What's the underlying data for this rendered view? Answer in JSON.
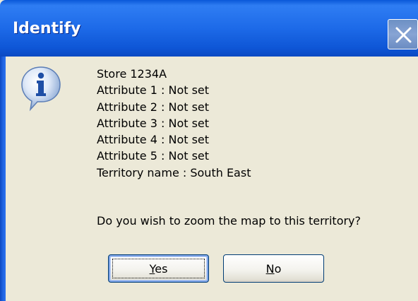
{
  "window": {
    "title": "Identify"
  },
  "message": {
    "lines": [
      "Store 1234A",
      "Attribute 1 : Not set",
      "Attribute 2 : Not set",
      "Attribute 3 : Not set",
      "Attribute 4 : Not set",
      "Attribute 5 : Not set",
      "Territory name : South East"
    ],
    "question": "Do you wish to zoom the map to this territory?"
  },
  "buttons": {
    "yes": {
      "mnemonic": "Y",
      "rest": "es"
    },
    "no": {
      "mnemonic": "N",
      "rest": "o"
    }
  },
  "icons": {
    "info": "information-icon",
    "close": "close-icon"
  },
  "colors": {
    "titlebar": "#1d6ae8",
    "dialog_bg": "#ece9d8",
    "button_border": "#003c74"
  }
}
